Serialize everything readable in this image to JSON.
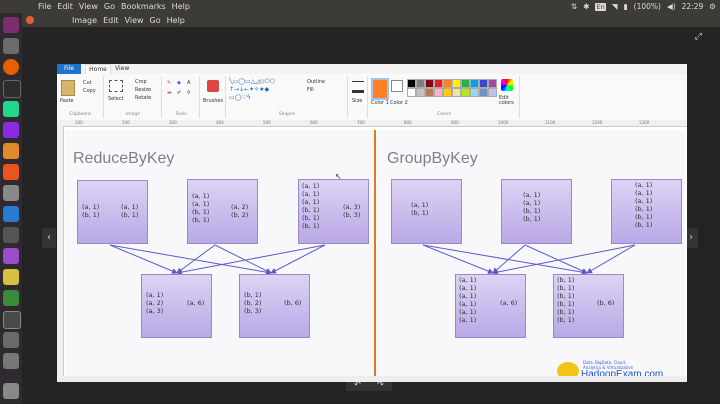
{
  "top_panel": {
    "menu": [
      "File",
      "Edit",
      "View",
      "Go",
      "Bookmarks",
      "Help"
    ],
    "keyboard": "En",
    "battery": "(100%)",
    "time": "22:29"
  },
  "viewer": {
    "menu": [
      "Image",
      "Edit",
      "View",
      "Go",
      "Help"
    ]
  },
  "paint": {
    "tabs": {
      "file": "File",
      "home": "Home",
      "view": "View"
    },
    "ribbon": {
      "paste": "Paste",
      "cut": "Cut",
      "copy": "Copy",
      "clipboard": "Clipboard",
      "select": "Select",
      "crop": "Crop",
      "resize": "Resize",
      "rotate": "Rotate",
      "image": "Image",
      "tools": "Tools",
      "brushes": "Brushes",
      "shapes": "Shapes",
      "outline": "Outline",
      "fill": "Fill",
      "size": "Size",
      "color1": "Color 1",
      "color2": "Color 2",
      "colors": "Colors",
      "edit_colors": "Edit colors"
    },
    "ruler_h": [
      "100",
      "200",
      "300",
      "400",
      "500",
      "600",
      "700",
      "800",
      "900",
      "1000",
      "1100",
      "1200",
      "1300"
    ],
    "ruler_v": [
      "100",
      "200",
      "300",
      "400"
    ],
    "palette": [
      "#000000",
      "#7f7f7f",
      "#880015",
      "#ed1c24",
      "#ff7f27",
      "#fff200",
      "#22b14c",
      "#00a2e8",
      "#3f48cc",
      "#a349a4",
      "#ffffff",
      "#c3c3c3",
      "#b97a57",
      "#ffaec9",
      "#ffc90e",
      "#efe4b0",
      "#b5e61d",
      "#99d9ea",
      "#7092be",
      "#c8bfe7"
    ],
    "accent": "#1e73c9"
  },
  "diagram": {
    "reduce": {
      "title": "ReduceByKey",
      "top_boxes": [
        {
          "lines": [
            "(a, 1)",
            "(b, 1)"
          ],
          "result": [
            "(a, 1)",
            "(b, 1)"
          ]
        },
        {
          "lines": [
            "(a, 1)",
            "(a, 1)",
            "(b, 1)",
            "(b, 1)"
          ],
          "result": [
            "(a, 2)",
            "(b, 2)"
          ]
        },
        {
          "lines": [
            "(a, 1)",
            "(a, 1)",
            "(a, 1)",
            "(b, 1)",
            "(b, 1)",
            "(b, 1)"
          ],
          "result": [
            "(a, 3)",
            "(b, 3)"
          ]
        }
      ],
      "bottom_boxes": [
        {
          "lines": [
            "(a, 1)",
            "(a, 2)",
            "(a, 3)"
          ],
          "result": "(a, 6)"
        },
        {
          "lines": [
            "(b, 1)",
            "(b, 2)",
            "(b, 3)"
          ],
          "result": "(b, 6)"
        }
      ]
    },
    "group": {
      "title": "GroupByKey",
      "top_boxes": [
        {
          "lines": [
            "(a, 1)",
            "(b, 1)"
          ]
        },
        {
          "lines": [
            "(a, 1)",
            "(a, 1)",
            "(b, 1)",
            "(b, 1)"
          ]
        },
        {
          "lines": [
            "(a, 1)",
            "(a, 1)",
            "(a, 1)",
            "(b, 1)",
            "(b, 1)",
            "(b, 1)"
          ]
        }
      ],
      "bottom_boxes": [
        {
          "lines": [
            "(a, 1)",
            "(a, 1)",
            "(a, 1)",
            "(a, 1)",
            "(a, 1)",
            "(a, 1)"
          ],
          "result": "(a, 6)"
        },
        {
          "lines": [
            "(b, 1)",
            "(b, 1)",
            "(b, 1)",
            "(b, 1)",
            "(b, 1)",
            "(b, 1)"
          ],
          "result": "(b, 6)"
        }
      ]
    },
    "brand_small": [
      "Data, BigData, Cloud,",
      "Analytics & Virtualization"
    ],
    "brand_big": "HadoopExam.com",
    "divider_color": "#e2781a",
    "box_color": "#c9bdef"
  }
}
